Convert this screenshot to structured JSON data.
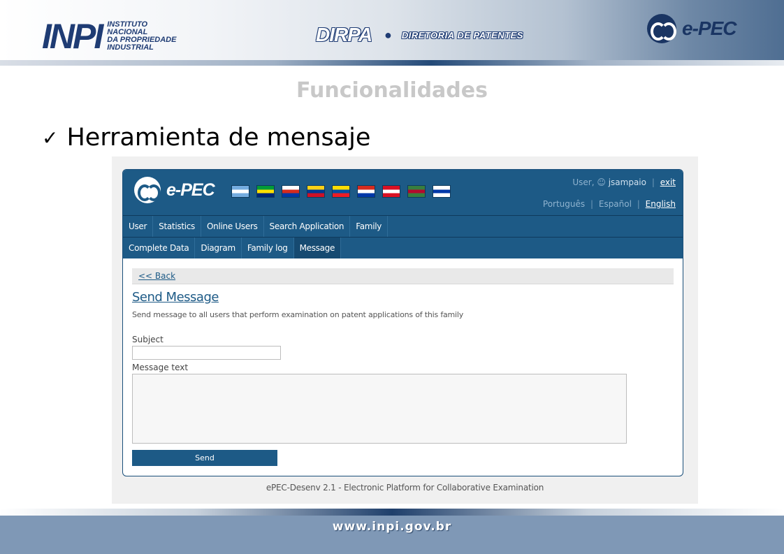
{
  "header": {
    "inpi_mark": "INPI",
    "inpi_lines": [
      "INSTITUTO",
      "NACIONAL",
      "DA PROPRIEDADE",
      "INDUSTRIAL"
    ],
    "dirpa_mark": "DIRPA",
    "dirpa_sub": "DIRETORIA DE PATENTES",
    "epec_brand": "e-PEC"
  },
  "slide": {
    "title": "Funcionalidades",
    "bullet_check": "✓",
    "bullet_text": "Herramienta de mensaje"
  },
  "app": {
    "brand": "e-PEC",
    "flags": [
      {
        "name": "argentina",
        "colors": [
          "#74acdf",
          "#ffffff",
          "#74acdf"
        ]
      },
      {
        "name": "brazil",
        "colors": [
          "#009b3a",
          "#fedf00",
          "#002776"
        ]
      },
      {
        "name": "chile",
        "colors": [
          "#ffffff",
          "#d52b1e",
          "#0039a6"
        ]
      },
      {
        "name": "colombia",
        "colors": [
          "#fcd116",
          "#003893",
          "#ce1126"
        ]
      },
      {
        "name": "ecuador",
        "colors": [
          "#ffdd00",
          "#034ea2",
          "#ed1c24"
        ]
      },
      {
        "name": "paraguay",
        "colors": [
          "#d52b1e",
          "#ffffff",
          "#0038a8"
        ]
      },
      {
        "name": "peru",
        "colors": [
          "#d91023",
          "#ffffff",
          "#d91023"
        ]
      },
      {
        "name": "suriname",
        "colors": [
          "#377e3f",
          "#b40a2d",
          "#377e3f"
        ]
      },
      {
        "name": "uruguay",
        "colors": [
          "#ffffff",
          "#0038a8",
          "#ffffff"
        ]
      }
    ],
    "user_prefix": "User,",
    "username": "jsampaio",
    "separator": "|",
    "exit_label": "exit",
    "languages": {
      "portuguese": "Português",
      "spanish": "Español",
      "english": "English",
      "active": "English"
    },
    "nav_primary": [
      "User",
      "Statistics",
      "Online Users",
      "Search Application",
      "Family"
    ],
    "nav_secondary": [
      "Complete Data",
      "Diagram",
      "Family log",
      "Message"
    ],
    "nav_secondary_active": "Message",
    "back_label": "<< Back",
    "page_title": "Send Message",
    "page_description": "Send message to all users that perform examination on patent applications of this family",
    "subject_label": "Subject",
    "subject_value": "",
    "message_label": "Message text",
    "message_value": "",
    "send_label": "Send",
    "footer": "ePEC-Desenv 2.1 - Electronic Platform for Collaborative Examination"
  },
  "footer": {
    "url": "www.inpi.gov.br"
  },
  "colors": {
    "app_primary": "#1d5a86",
    "inpi_navy": "#1f3c74",
    "title_gray": "#c8c8c8"
  }
}
